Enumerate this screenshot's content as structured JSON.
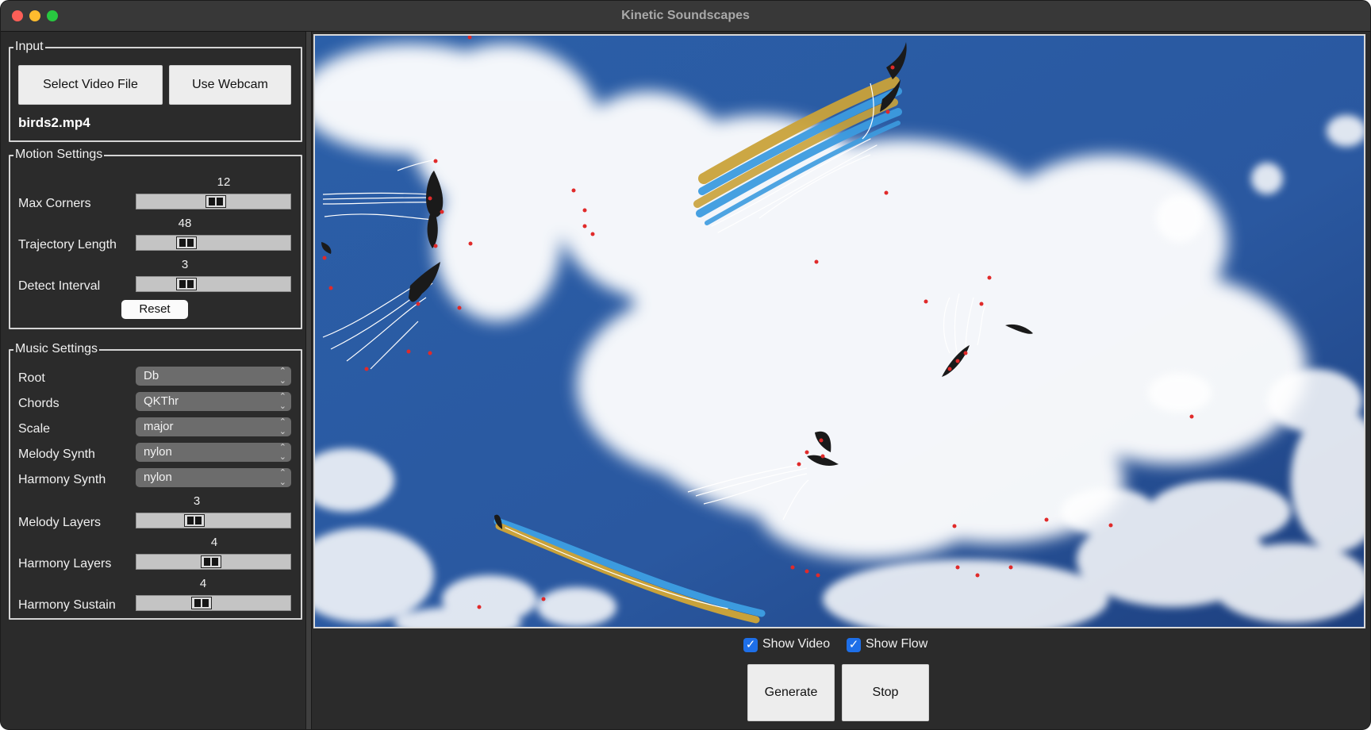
{
  "window": {
    "title": "Kinetic Soundscapes"
  },
  "input": {
    "title": "Input",
    "select_video_label": "Select Video File",
    "webcam_label": "Use Webcam",
    "filename": "birds2.mp4"
  },
  "motion": {
    "title": "Motion Settings",
    "max_corners": {
      "label": "Max Corners",
      "value": "12",
      "fraction": 0.52
    },
    "trajectory_length": {
      "label": "Trajectory Length",
      "value": "48",
      "fraction": 0.3
    },
    "detect_interval": {
      "label": "Detect Interval",
      "value": "3",
      "fraction": 0.3
    },
    "reset_label": "Reset"
  },
  "music": {
    "title": "Music Settings",
    "root": {
      "label": "Root",
      "value": "Db"
    },
    "chords": {
      "label": "Chords",
      "value": "QKThr"
    },
    "scale": {
      "label": "Scale",
      "value": "major"
    },
    "melody_synth": {
      "label": "Melody Synth",
      "value": "nylon"
    },
    "harmony_synth": {
      "label": "Harmony Synth",
      "value": "nylon"
    },
    "melody_layers": {
      "label": "Melody Layers",
      "value": "3",
      "fraction": 0.36
    },
    "harmony_layers": {
      "label": "Harmony Layers",
      "value": "4",
      "fraction": 0.48
    },
    "harmony_sustain": {
      "label": "Harmony Sustain",
      "value": "4",
      "fraction": 0.41
    }
  },
  "controls": {
    "show_video_label": "Show Video",
    "show_flow_label": "Show Flow",
    "generate_label": "Generate",
    "stop_label": "Stop",
    "show_video_checked": true,
    "show_flow_checked": true
  },
  "colors": {
    "background": "#2b2b2b",
    "accent": "#1e6fe8",
    "trail_gold": "#c9a23a",
    "trail_blue": "#3c9bdf",
    "point_red": "#e02a2a"
  }
}
